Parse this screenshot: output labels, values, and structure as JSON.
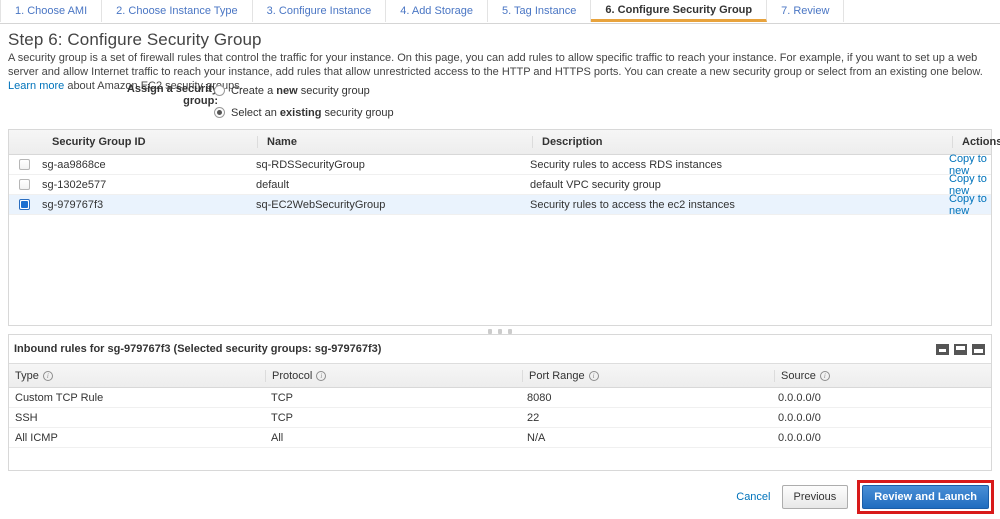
{
  "wizard": {
    "tabs": [
      {
        "label": "1. Choose AMI",
        "active": false
      },
      {
        "label": "2. Choose Instance Type",
        "active": false
      },
      {
        "label": "3. Configure Instance",
        "active": false
      },
      {
        "label": "4. Add Storage",
        "active": false
      },
      {
        "label": "5. Tag Instance",
        "active": false
      },
      {
        "label": "6. Configure Security Group",
        "active": true
      },
      {
        "label": "7. Review",
        "active": false
      }
    ]
  },
  "step": {
    "title": "Step 6: Configure Security Group",
    "description_part1": "A security group is a set of firewall rules that control the traffic for your instance. On this page, you can add rules to allow specific traffic to reach your instance. For example, if you want to set up a web server and allow Internet traffic to reach your instance, add rules that allow unrestricted access to the HTTP and HTTPS ports. You can create a new security group or select from an existing one below. ",
    "learn_more": "Learn more",
    "description_part2": " about Amazon EC2 security groups."
  },
  "assign": {
    "label": "Assign a security group:",
    "options": [
      {
        "pre": "Create a ",
        "strong": "new",
        "post": " security group",
        "selected": false
      },
      {
        "pre": "Select an ",
        "strong": "existing",
        "post": " security group",
        "selected": true
      }
    ]
  },
  "security_groups": {
    "columns": [
      "Security Group ID",
      "Name",
      "Description",
      "Actions"
    ],
    "rows": [
      {
        "checked": false,
        "id": "sg-aa9868ce",
        "name": "sq-RDSSecurityGroup",
        "description": "Security rules to access RDS instances",
        "action": "Copy to new"
      },
      {
        "checked": false,
        "id": "sg-1302e577",
        "name": "default",
        "description": "default VPC security group",
        "action": "Copy to new"
      },
      {
        "checked": true,
        "id": "sg-979767f3",
        "name": "sq-EC2WebSecurityGroup",
        "description": "Security rules to access the ec2 instances",
        "action": "Copy to new"
      }
    ]
  },
  "inbound": {
    "title": "Inbound rules for sg-979767f3 (Selected security groups: sg-979767f3)",
    "view_icons": [
      "panel-bottom-icon",
      "panel-split-bottom-icon",
      "panel-split-top-icon"
    ],
    "columns": [
      "Type",
      "Protocol",
      "Port Range",
      "Source"
    ],
    "rows": [
      {
        "type": "Custom TCP Rule",
        "protocol": "TCP",
        "port_range": "8080",
        "source": "0.0.0.0/0"
      },
      {
        "type": "SSH",
        "protocol": "TCP",
        "port_range": "22",
        "source": "0.0.0.0/0"
      },
      {
        "type": "All ICMP",
        "protocol": "All",
        "port_range": "N/A",
        "source": "0.0.0.0/0"
      }
    ]
  },
  "footer": {
    "cancel": "Cancel",
    "previous": "Previous",
    "review_and_launch": "Review and Launch"
  },
  "colors": {
    "accent_tab": "#e8a33d",
    "link": "#0073bb",
    "primary_button": "#1f6dc0",
    "highlight_box": "#d81a1a",
    "selected_row": "#eaf3fd"
  }
}
